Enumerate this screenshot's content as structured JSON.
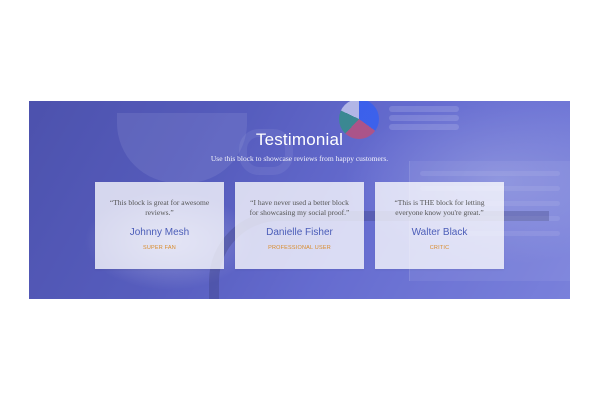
{
  "section": {
    "title": "Testimonial",
    "subtitle": "Use this block to showcase reviews from happy customers."
  },
  "testimonials": [
    {
      "quote": "“This block is great for awesome reviews.”",
      "name": "Johnny Mesh",
      "role": "SUPER FAN"
    },
    {
      "quote": "“I have never used a better block for showcasing my social proof.”",
      "name": "Danielle Fisher",
      "role": "PROFESSIONAL USER"
    },
    {
      "quote": "“This is THE block for letting everyone know you're great.”",
      "name": "Walter Black",
      "role": "CRITIC"
    }
  ],
  "colors": {
    "accent_name": "#4b5db8",
    "accent_role": "#d98b2b",
    "overlay": "#5a5fb6"
  }
}
